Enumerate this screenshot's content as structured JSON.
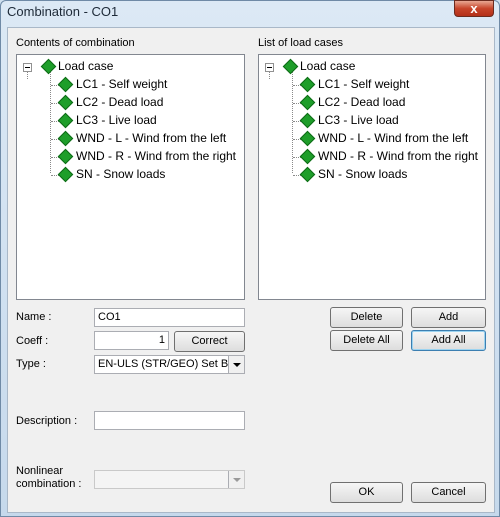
{
  "window": {
    "title": "Combination - CO1",
    "close_glyph": "x"
  },
  "left_panel": {
    "label": "Contents of combination",
    "root": "Load case",
    "items": [
      "LC1 - Self weight",
      "LC2 - Dead load",
      "LC3 - Live load",
      "WND - L - Wind from the left",
      "WND - R - Wind from the right",
      "SN - Snow loads"
    ]
  },
  "right_panel": {
    "label": "List of load cases",
    "root": "Load case",
    "items": [
      "LC1 - Self weight",
      "LC2 - Dead load",
      "LC3 - Live load",
      "WND - L - Wind from the left",
      "WND - R - Wind from the right",
      "SN - Snow loads"
    ]
  },
  "form": {
    "name_label": "Name :",
    "name_value": "CO1",
    "coeff_label": "Coeff :",
    "coeff_value": "1",
    "correct_label": "Correct",
    "type_label": "Type :",
    "type_value": "EN-ULS (STR/GEO) Set B",
    "description_label": "Description :",
    "description_value": "",
    "nonlinear_label_1": "Nonlinear",
    "nonlinear_label_2": "combination :",
    "nonlinear_value": ""
  },
  "buttons": {
    "delete": "Delete",
    "add": "Add",
    "delete_all": "Delete All",
    "add_all": "Add All",
    "ok": "OK",
    "cancel": "Cancel"
  },
  "colors": {
    "node_icon": "#1e9e2a",
    "titlebar": "#dce9f5",
    "close_button": "#c7452a"
  },
  "icons": {
    "node": "green-diamond-icon",
    "collapse": "minus-box-icon"
  }
}
